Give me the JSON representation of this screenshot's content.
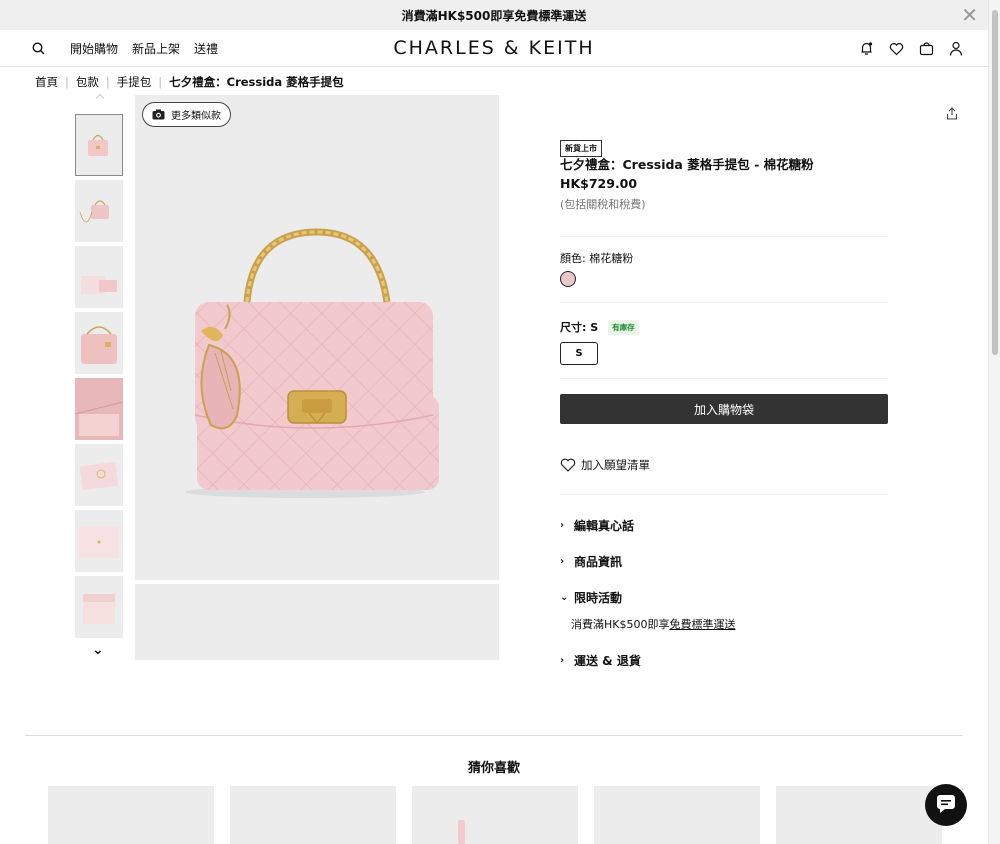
{
  "promo": {
    "text_prefix": "消費滿HK$500即享",
    "text_bold": "免費標準運送"
  },
  "header": {
    "nav": [
      "開始購物",
      "新品上架",
      "送禮"
    ],
    "logo": "CHARLES & KEITH"
  },
  "breadcrumb": [
    "首頁",
    "包款",
    "手提包",
    "七夕禮盒：Cressida 菱格手提包"
  ],
  "gallery": {
    "similar_label": "更多類似款",
    "thumbnail_count": 8
  },
  "product": {
    "badge": "新貨上市",
    "title": "七夕禮盒：Cressida 菱格手提包 - 棉花糖粉",
    "price": "HK$729.00",
    "tax_note": "(包括關稅和稅費)",
    "color_label": "顏色: 棉花糖粉",
    "color_hex": "#ecc9c9",
    "size_label": "尺寸: S",
    "stock_badge": "有庫存",
    "size_option": "S",
    "add_to_cart": "加入購物袋",
    "wishlist": "加入願望清單"
  },
  "accordion": [
    {
      "label": "編輯真心話",
      "expanded": false
    },
    {
      "label": "商品資訊",
      "expanded": false
    },
    {
      "label": "限時活動",
      "expanded": true,
      "content_prefix": "消費滿HK$500即享",
      "content_link": "免費標準運送"
    },
    {
      "label": "運送 & 退貨",
      "expanded": false
    }
  ],
  "recommendations": {
    "title": "猜你喜歡",
    "card_count": 5
  }
}
